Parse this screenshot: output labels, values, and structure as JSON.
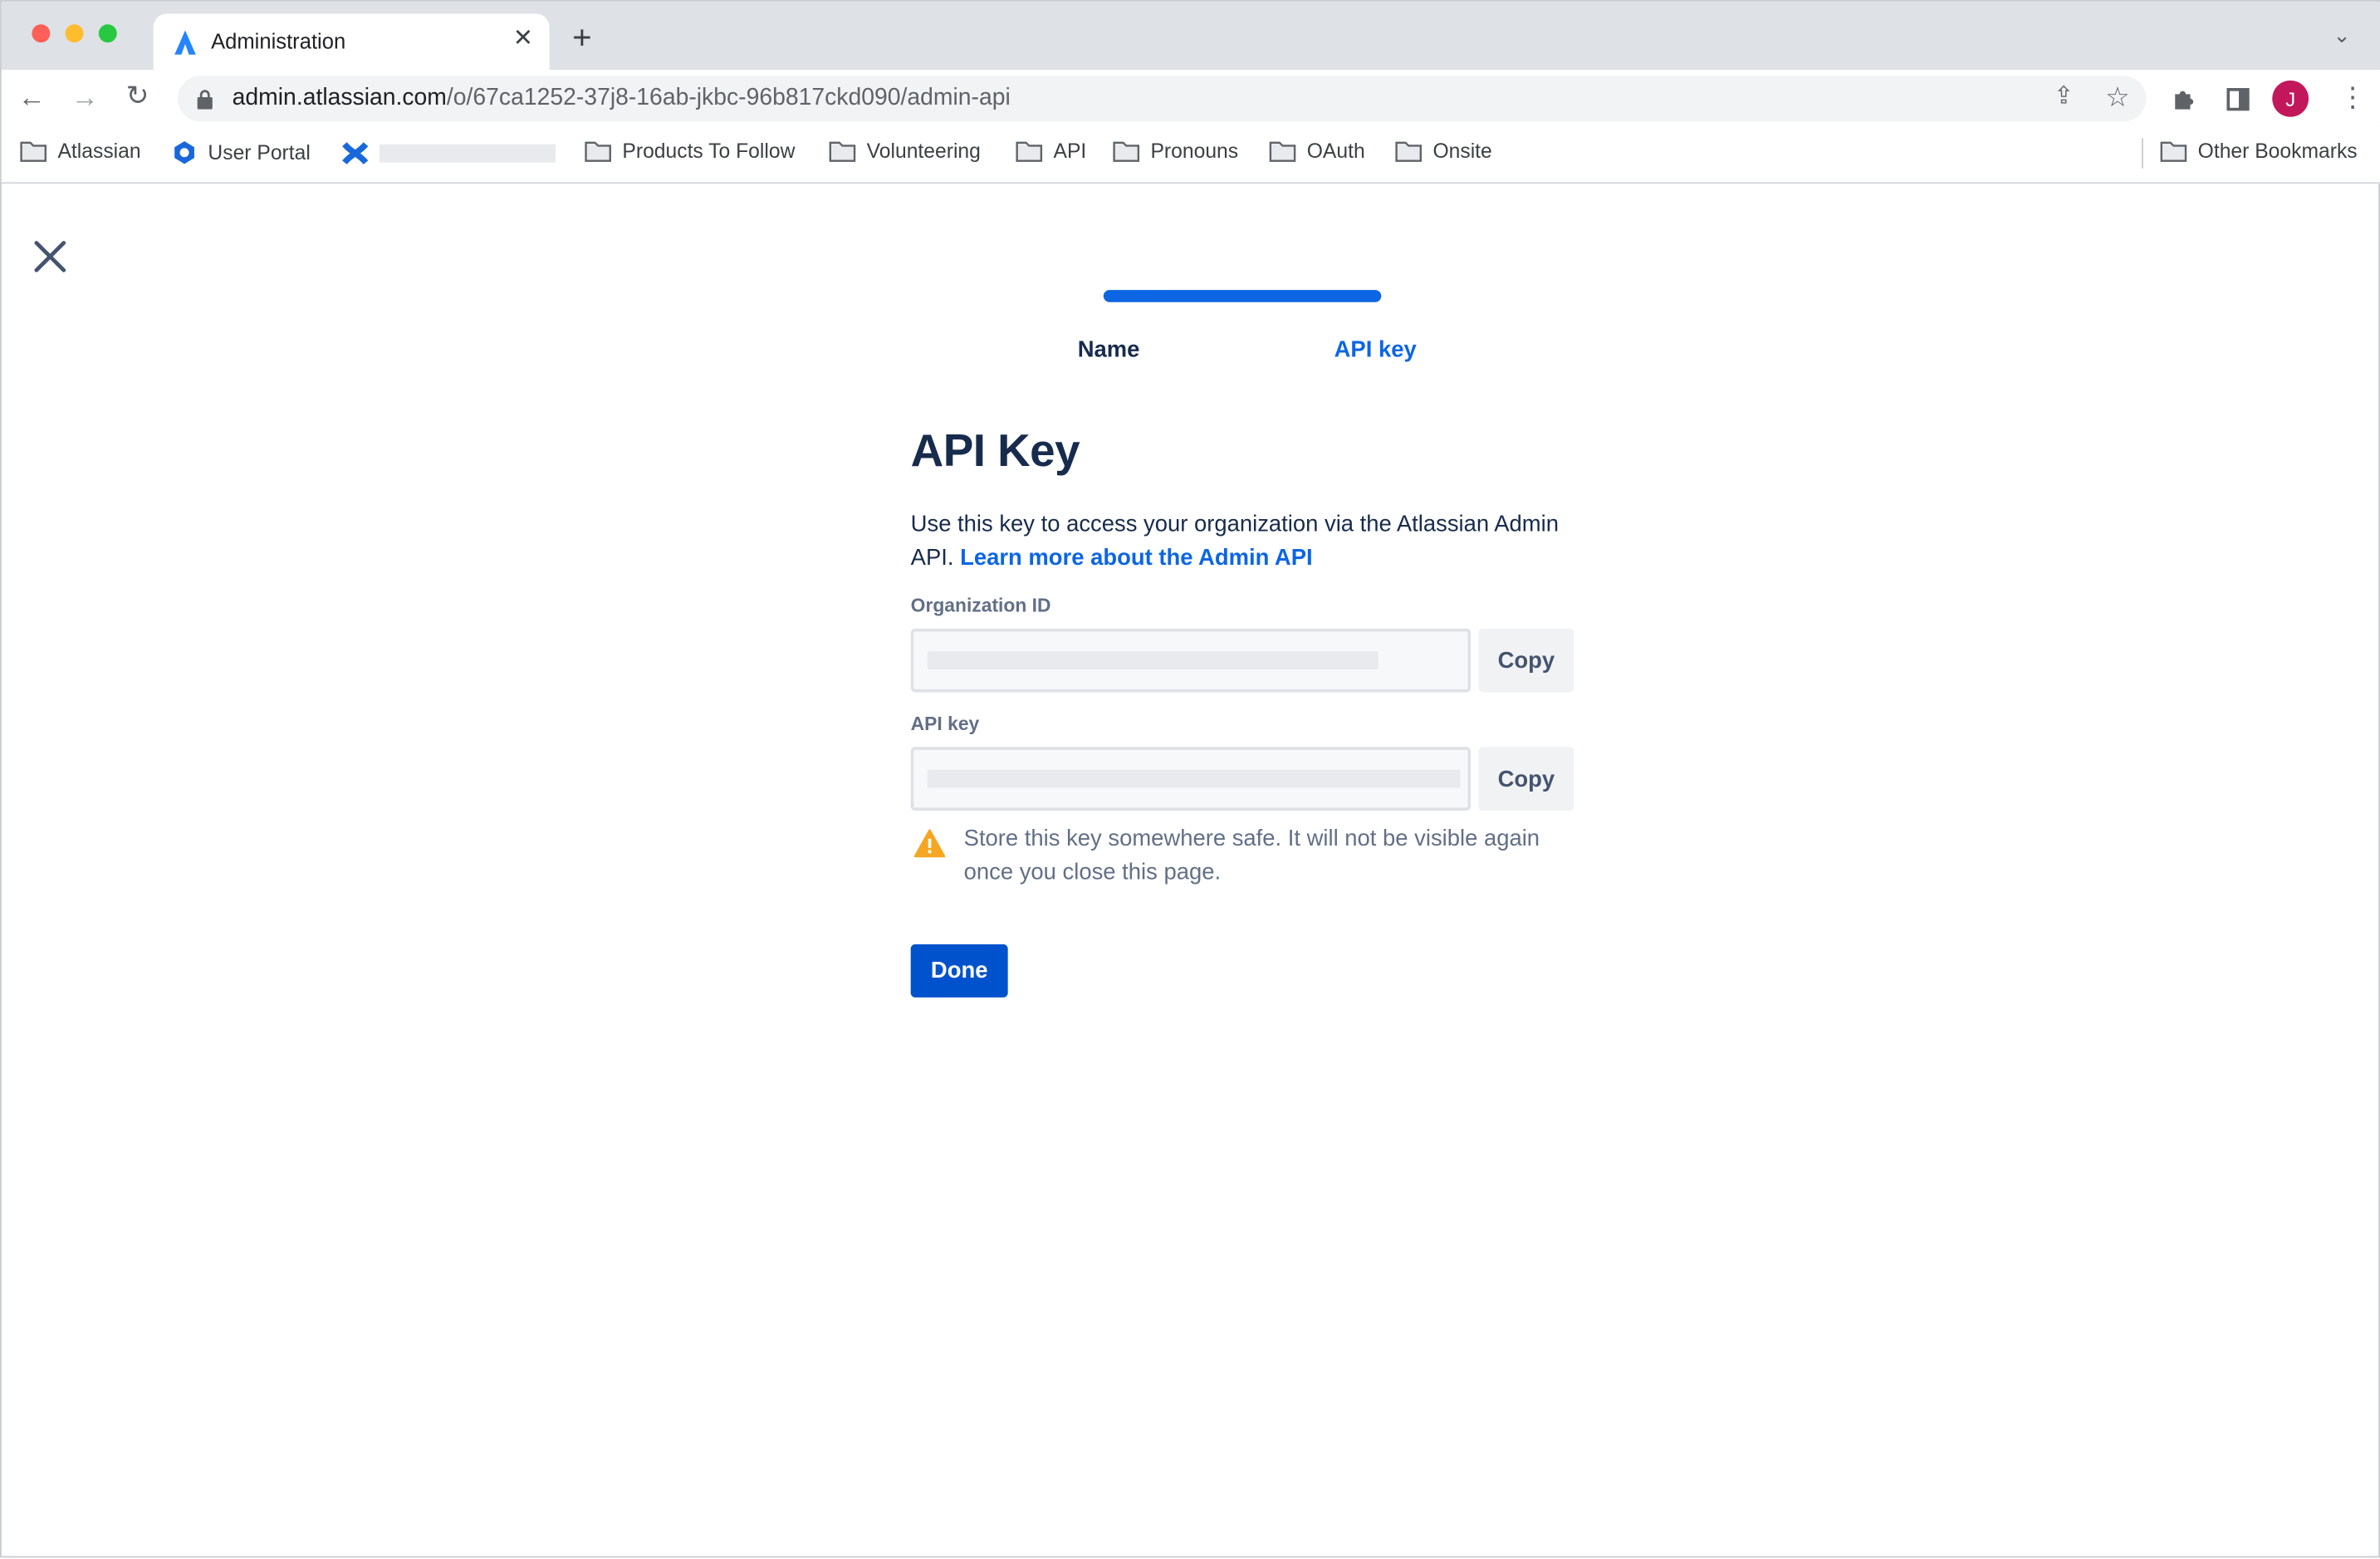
{
  "browser": {
    "tab_title": "Administration",
    "url_host": "admin.atlassian.com",
    "url_path": "/o/67ca1252-37j8-16ab-jkbc-96b817ckd090/admin-api",
    "avatar_initial": "J",
    "avatar_color": "#c2185b",
    "bookmarks": [
      {
        "label": "Atlassian",
        "icon": "folder-icon"
      },
      {
        "label": "User Portal",
        "icon": "user-portal-icon"
      },
      {
        "label": "",
        "icon": "confluence-icon"
      },
      {
        "label": "Products To Follow",
        "icon": "folder-icon"
      },
      {
        "label": "Volunteering",
        "icon": "folder-icon"
      },
      {
        "label": "API",
        "icon": "folder-icon"
      },
      {
        "label": "Pronouns",
        "icon": "folder-icon"
      },
      {
        "label": "OAuth",
        "icon": "folder-icon"
      },
      {
        "label": "Onsite",
        "icon": "folder-icon"
      }
    ],
    "other_bookmarks": "Other Bookmarks"
  },
  "wizard": {
    "steps": [
      "Name",
      "API key"
    ],
    "active_step": 2,
    "progress_percent": 100,
    "accent": "#0c66e4"
  },
  "page": {
    "title": "API Key",
    "description": "Use this key to access your organization via the Atlassian Admin API.",
    "learn_more_link": "Learn more about the Admin API",
    "org_id_label": "Organization ID",
    "api_key_label": "API key",
    "copy_label": "Copy",
    "warning": "Store this key somewhere safe. It will not be visible again once you close this page.",
    "done_label": "Done"
  }
}
